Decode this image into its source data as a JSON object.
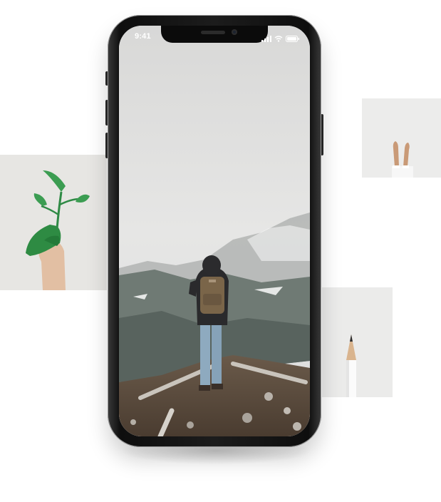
{
  "status_bar": {
    "time": "9:41",
    "icons": [
      "signal-icon",
      "wifi-icon",
      "battery-icon"
    ]
  },
  "photos": [
    {
      "name": "green-painted-hand-with-plant"
    },
    {
      "name": "feet-on-white-wall"
    },
    {
      "name": "white-pencil"
    }
  ],
  "screen": {
    "wallpaper": "hiker-with-backpack-on-misty-mountain"
  },
  "colors": {
    "page_background": "#ffffff",
    "phone_frame": "#1a1a1a",
    "leaf_green": "#2f8a45",
    "sky": "#dededd"
  }
}
